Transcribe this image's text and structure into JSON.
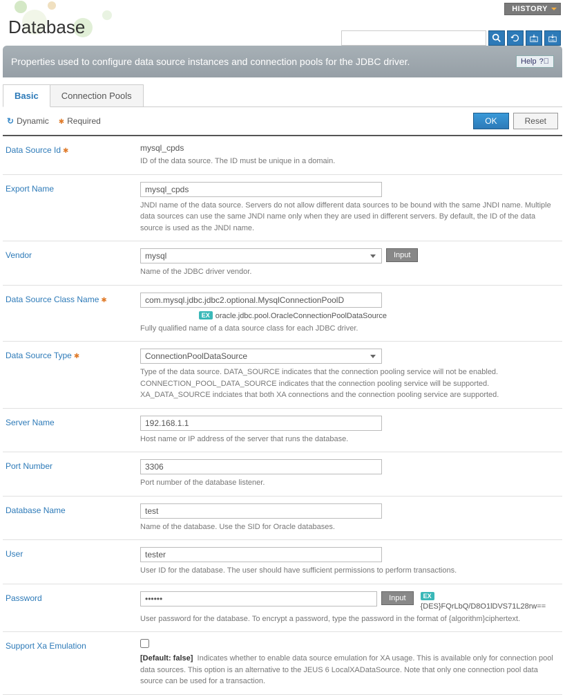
{
  "header": {
    "title": "Database",
    "history": "HISTORY"
  },
  "info": {
    "text": "Properties used to configure data source instances and connection pools for the JDBC driver.",
    "help": "Help"
  },
  "tabs": {
    "basic": "Basic",
    "pools": "Connection Pools"
  },
  "legend": {
    "dynamic": "Dynamic",
    "required": "Required",
    "ok": "OK",
    "reset": "Reset"
  },
  "inputBtn": "Input",
  "fields": {
    "dsid": {
      "label": "Data Source Id",
      "value": "mysql_cpds",
      "desc": "ID of the data source. The ID must be unique in a domain."
    },
    "export": {
      "label": "Export Name",
      "value": "mysql_cpds",
      "desc": "JNDI name of the data source. Servers do not allow different data sources to be bound with the same JNDI name. Multiple data sources can use the same JNDI name only when they are used in different servers. By default, the ID of the data source is used as the JNDI name."
    },
    "vendor": {
      "label": "Vendor",
      "value": "mysql",
      "desc": "Name of the JDBC driver vendor."
    },
    "dsclass": {
      "label": "Data Source Class Name",
      "value": "com.mysql.jdbc.jdbc2.optional.MysqlConnectionPoolD",
      "example": "oracle.jdbc.pool.OracleConnectionPoolDataSource",
      "desc": "Fully qualified name of a data source class for each JDBC driver."
    },
    "dstype": {
      "label": "Data Source Type",
      "value": "ConnectionPoolDataSource",
      "desc": "Type of the data source. DATA_SOURCE indicates that the connection pooling service will not be enabled. CONNECTION_POOL_DATA_SOURCE indicates that the connection pooling service will be supported. XA_DATA_SOURCE indciates that both XA connections and the connection pooling service are supported."
    },
    "server": {
      "label": "Server Name",
      "value": "192.168.1.1",
      "desc": "Host name or IP address of the server that runs the database."
    },
    "port": {
      "label": "Port Number",
      "value": "3306",
      "desc": "Port number of the database listener."
    },
    "dbname": {
      "label": "Database Name",
      "value": "test",
      "desc": "Name of the database. Use the SID for Oracle databases."
    },
    "user": {
      "label": "User",
      "value": "tester",
      "desc": "User ID for the database. The user should have sufficient permissions to perform transactions."
    },
    "password": {
      "label": "Password",
      "value": "••••••",
      "example": "{DES}FQrLbQ/D8O1lDVS71L28rw==",
      "desc": "User password for the database. To encrypt a password, type the password in the format of {algorithm}ciphertext."
    },
    "xa": {
      "label": "Support Xa Emulation",
      "default": "[Default: false]",
      "desc": "Indicates whether to enable data source emulation for XA usage. This is available only for connection pool data sources. This option is an alternative to the JEUS 6 LocalXADataSource. Note that only one connection pool data source can be used for a transaction."
    }
  }
}
